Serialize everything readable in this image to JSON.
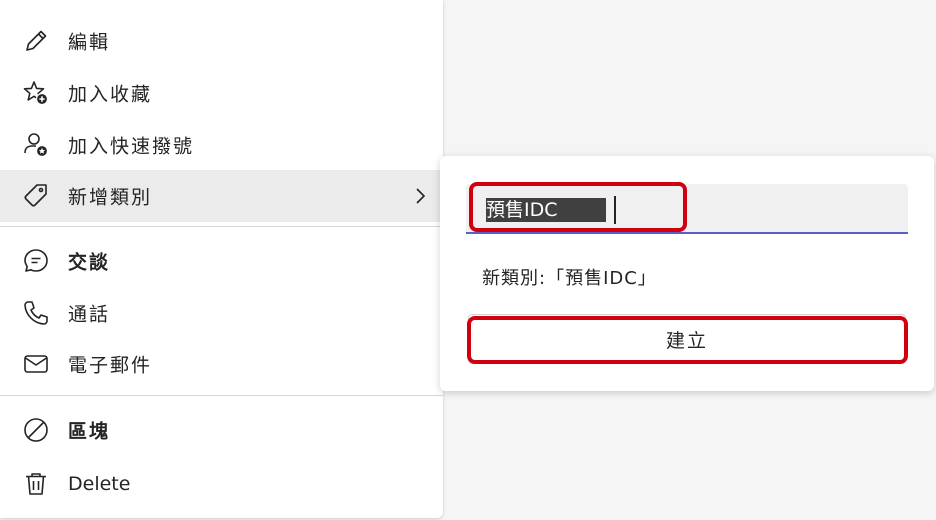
{
  "menu": {
    "items": [
      {
        "label": "編輯",
        "icon": "pencil-icon"
      },
      {
        "label": "加入收藏",
        "icon": "star-add-icon"
      },
      {
        "label": "加入快速撥號",
        "icon": "person-star-icon"
      },
      {
        "label": "新增類別",
        "icon": "tag-icon"
      },
      {
        "label": "交談",
        "icon": "chat-icon"
      },
      {
        "label": "通話",
        "icon": "phone-icon"
      },
      {
        "label": "電子郵件",
        "icon": "mail-icon"
      },
      {
        "label": "區塊",
        "icon": "block-icon"
      },
      {
        "label": "Delete",
        "icon": "trash-icon"
      }
    ]
  },
  "submenu": {
    "category_input_value": "預售IDC",
    "preview_text": "新類別:「預售IDC」",
    "create_button_label": "建立"
  },
  "colors": {
    "highlight_border": "#d1000f",
    "input_underline": "#5b5fc7",
    "selected_row_bg": "#ebebeb"
  }
}
